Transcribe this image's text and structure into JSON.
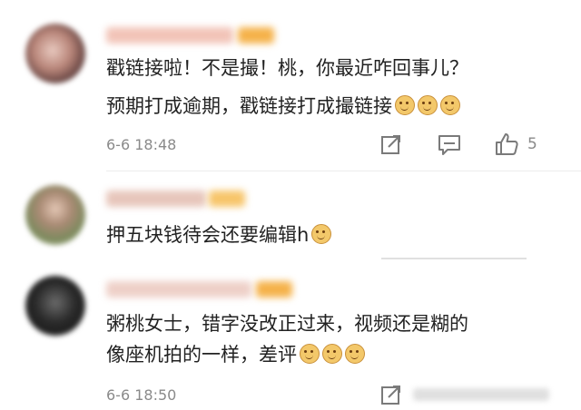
{
  "comments": [
    {
      "text_line1": "戳链接啦！不是撮！桃，你最近咋回事儿？",
      "text_line2": "预期打成逾期，戳链接打成撮链接",
      "time": "6-6 18:48",
      "like_count": "5",
      "emoji_count": 3
    },
    {
      "text_line1": "押五块钱待会还要编辑h",
      "emoji_count": 1
    },
    {
      "text_line1": "粥桃女士，错字没改正过来，视频还是糊的",
      "text_line2": "像座机拍的一样，差评",
      "time": "6-6 18:50",
      "emoji_count": 3
    }
  ],
  "icons": {
    "share": "share-icon",
    "comment": "comment-icon",
    "like": "thumbs-up-icon"
  },
  "colors": {
    "text": "#222222",
    "muted": "#8a8a8a",
    "badge": "#f5b24a"
  }
}
